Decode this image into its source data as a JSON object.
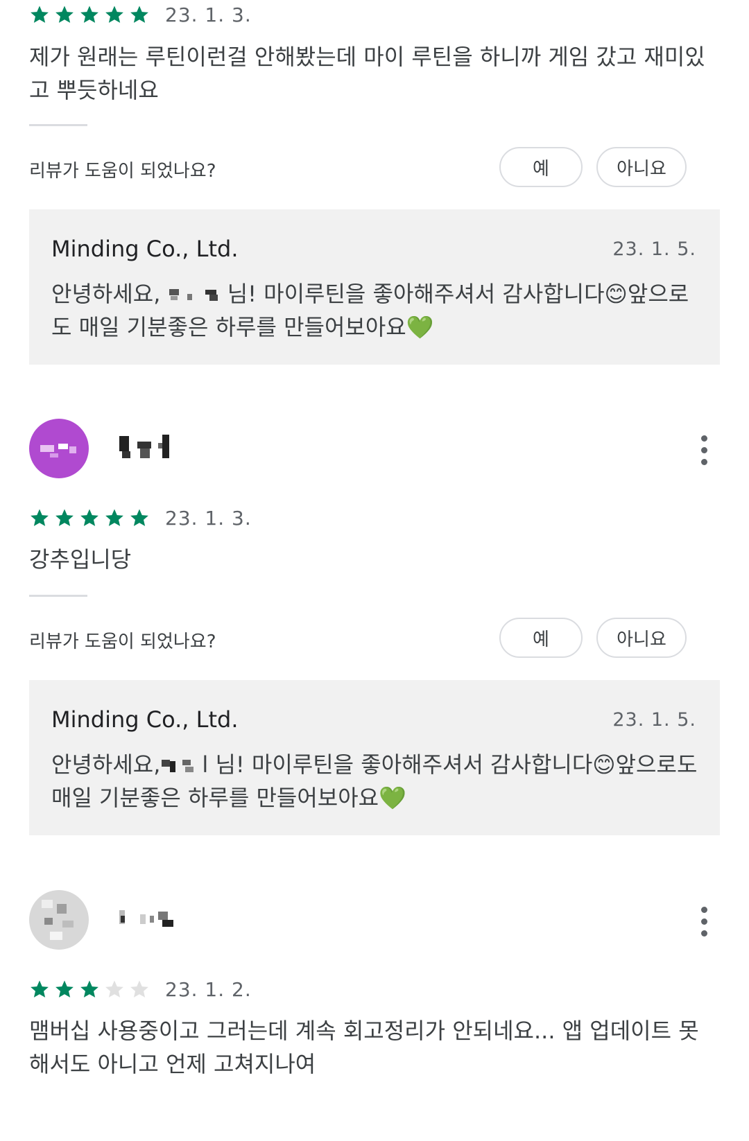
{
  "reviews": [
    {
      "stars": 5,
      "date": "23. 1. 3.",
      "text": "제가 원래는 루틴이런걸 안해봤는데 마이 루틴을 하니까 게임 갔고 재미있고 뿌듯하네요",
      "helpful_question": "리뷰가 도움이 되었나요?",
      "yes_label": "예",
      "no_label": "아니요",
      "reply": {
        "developer": "Minding Co., Ltd.",
        "date": "23. 1. 5.",
        "text_pre": "안녕하세요, ",
        "text_post": " 님! 마이루틴을 좋아해주셔서 감사합니다😊앞으로도 매일 기분좋은 하루를 만들어보아요💚"
      }
    },
    {
      "avatar_color": "#b04ad0",
      "stars": 5,
      "date": "23. 1. 3.",
      "text": "강추입니당",
      "helpful_question": "리뷰가 도움이 되었나요?",
      "yes_label": "예",
      "no_label": "아니요",
      "reply": {
        "developer": "Minding Co., Ltd.",
        "date": "23. 1. 5.",
        "text_pre": "안녕하세요,",
        "text_post": "l 님! 마이루틴을 좋아해주셔서 감사합니다😊앞으로도 매일 기분좋은 하루를 만들어보아요💚"
      }
    },
    {
      "avatar_color": "#d8d8d8",
      "stars": 3,
      "date": "23. 1. 2.",
      "text": "맴버십 사용중이고 그러는데 계속 회고정리가 안되네요... 앱 업데이트 못해서도 아니고 언제 고쳐지나여"
    }
  ],
  "colors": {
    "star_filled": "#01875f",
    "star_empty": "#e0e0e0"
  },
  "icons": {
    "star": "star-icon",
    "more": "more-vert-icon"
  }
}
